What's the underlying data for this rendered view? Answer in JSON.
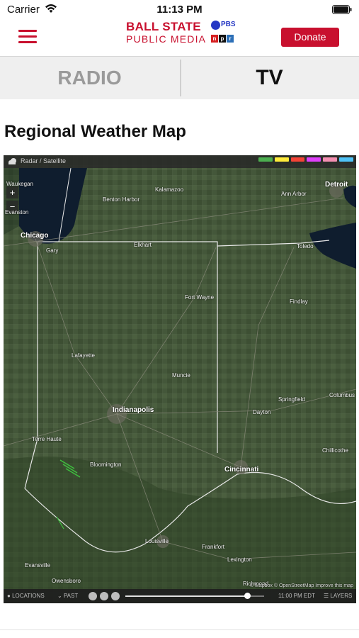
{
  "status_bar": {
    "carrier": "Carrier",
    "time": "11:13 PM"
  },
  "header": {
    "logo_line1": "BALL STATE",
    "logo_line2": "PUBLIC MEDIA",
    "pbs_label": "PBS",
    "npr_letters": [
      "n",
      "p",
      "r"
    ],
    "donate_label": "Donate",
    "brand_color": "#c8102e"
  },
  "tabs": [
    {
      "label": "RADIO",
      "selected": false
    },
    {
      "label": "TV",
      "selected": true
    }
  ],
  "page_title": "Regional Weather Map",
  "map": {
    "mode_label": "Radar / Satellite",
    "zoom_in": "+",
    "zoom_out": "−",
    "cities": [
      {
        "name": "Waukegan",
        "major": false
      },
      {
        "name": "Evanston",
        "major": false
      },
      {
        "name": "Chicago",
        "major": true
      },
      {
        "name": "Gary",
        "major": false
      },
      {
        "name": "Kalamazoo",
        "major": false
      },
      {
        "name": "Benton Harbor",
        "major": false
      },
      {
        "name": "Ann Arbor",
        "major": false
      },
      {
        "name": "Detroit",
        "major": true
      },
      {
        "name": "Elkhart",
        "major": false
      },
      {
        "name": "Toledo",
        "major": false
      },
      {
        "name": "Fort Wayne",
        "major": false
      },
      {
        "name": "Findlay",
        "major": false
      },
      {
        "name": "Lafayette",
        "major": false
      },
      {
        "name": "Muncie",
        "major": false
      },
      {
        "name": "Indianapolis",
        "major": true
      },
      {
        "name": "Dayton",
        "major": false
      },
      {
        "name": "Springfield",
        "major": false
      },
      {
        "name": "Columbus",
        "major": false
      },
      {
        "name": "Terre Haute",
        "major": false
      },
      {
        "name": "Bloomington",
        "major": false
      },
      {
        "name": "Cincinnati",
        "major": true
      },
      {
        "name": "Chillicothe",
        "major": false
      },
      {
        "name": "Louisville",
        "major": false
      },
      {
        "name": "Frankfort",
        "major": false
      },
      {
        "name": "Lexington",
        "major": false
      },
      {
        "name": "Evansville",
        "major": false
      },
      {
        "name": "Owensboro",
        "major": false
      },
      {
        "name": "Richmond",
        "major": false
      }
    ],
    "attribution": "© Mapbox © OpenStreetMap Improve this map",
    "controls": {
      "locations": "LOCATIONS",
      "past": "PAST",
      "time": "11:00 PM EDT",
      "layers": "LAYERS",
      "timeline_progress": 0.88
    },
    "legend_colors": [
      "#4caf50",
      "#ffeb3b",
      "#f44336",
      "#e040fb",
      "#f48fb1",
      "#4fc3f7"
    ]
  }
}
